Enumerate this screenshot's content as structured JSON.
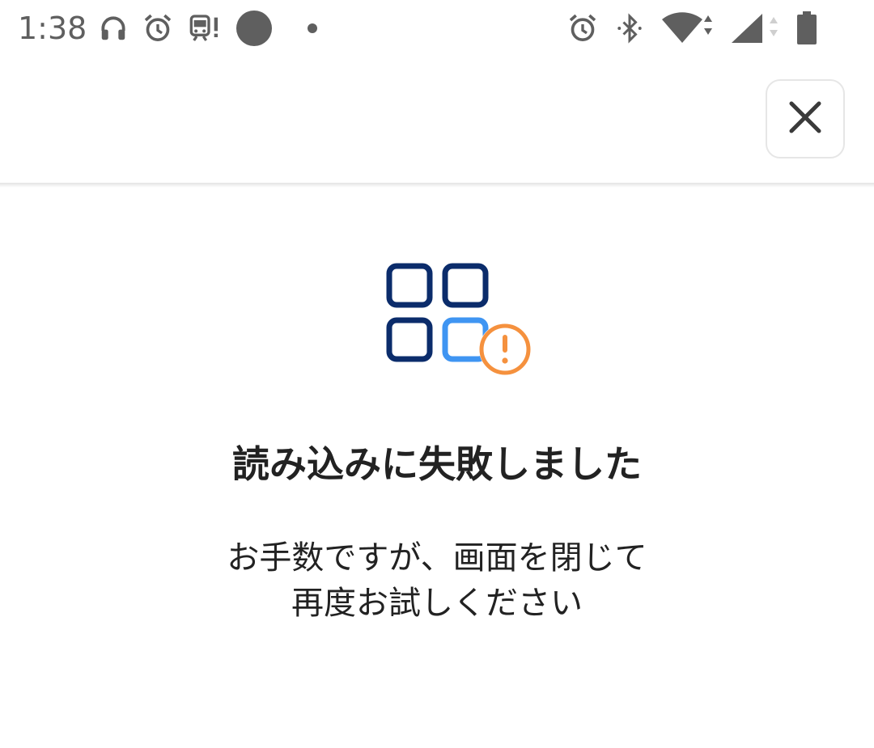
{
  "status_bar": {
    "time": "1:38",
    "left_icons": [
      "headphones-icon",
      "alarm-icon",
      "train-alert-icon",
      "circle-notification-icon",
      "dot-icon"
    ],
    "right_icons": [
      "alarm-icon",
      "bluetooth-icon",
      "wifi-icon",
      "cellular-signal-icon",
      "battery-icon"
    ]
  },
  "header": {
    "close_icon": "close-icon"
  },
  "error": {
    "title": "読み込みに失敗しました",
    "message_line1": "お手数ですが、画面を閉じて",
    "message_line2": "再度お試しください",
    "illustration_icon": "app-grid-error-icon"
  },
  "colors": {
    "dark_blue": "#0b2c6b",
    "light_blue": "#3f95f2",
    "warning_orange": "#f5913e",
    "text": "#222222",
    "status_gray": "#5f5f5f"
  }
}
